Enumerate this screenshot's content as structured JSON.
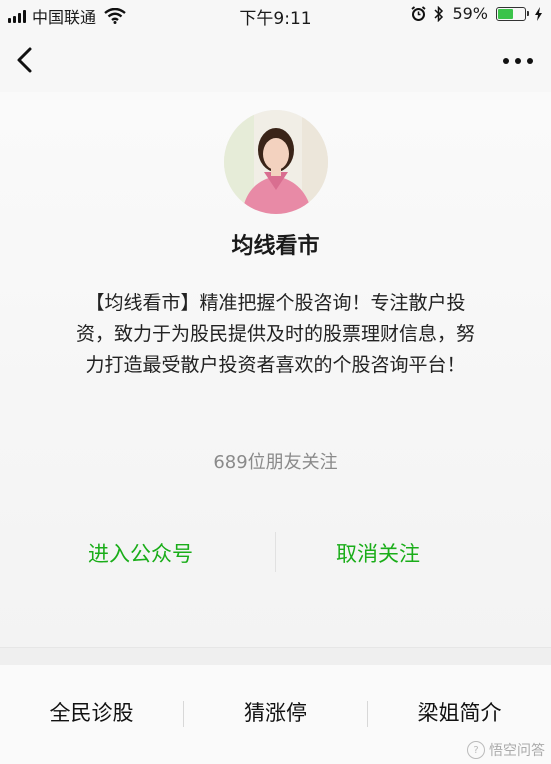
{
  "status_bar": {
    "carrier": "中国联通",
    "time": "下午9:11",
    "battery_percent": "59%",
    "battery_level": 0.59,
    "icons": [
      "signal-icon",
      "wifi-icon",
      "alarm-icon",
      "bluetooth-icon",
      "battery-icon",
      "charging-icon"
    ]
  },
  "nav": {
    "back_icon": "chevron-left-icon",
    "more_icon": "more-dots-icon"
  },
  "profile": {
    "name": "均线看市",
    "description": "【均线看市】精准把握个股咨询！专注散户投资，致力于为股民提供及时的股票理财信息，努力打造最受散户投资者喜欢的个股咨询平台！",
    "followers": "689位朋友关注"
  },
  "actions": {
    "enter_label": "进入公众号",
    "unfollow_label": "取消关注",
    "accent": "#1aad19"
  },
  "menu": {
    "items": [
      "全民诊股",
      "猜涨停",
      "梁姐简介"
    ]
  },
  "watermark": {
    "text": "悟空问答"
  }
}
